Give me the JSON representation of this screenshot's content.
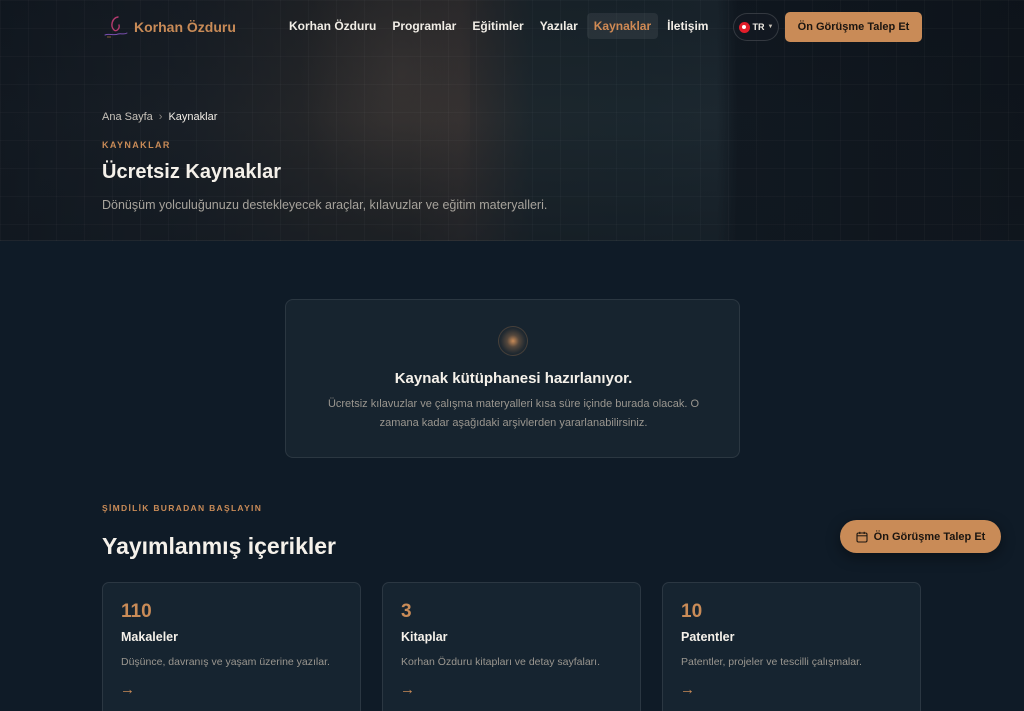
{
  "brand": {
    "name": "Korhan Özduru",
    "accent": "#c98b57",
    "logo_icon": "signature-logo-icon"
  },
  "nav": {
    "links": [
      {
        "label": "Korhan Özduru",
        "active": false
      },
      {
        "label": "Programlar",
        "active": false
      },
      {
        "label": "Eğitimler",
        "active": false
      },
      {
        "label": "Yazılar",
        "active": false
      },
      {
        "label": "Kaynaklar",
        "active": true
      },
      {
        "label": "İletişim",
        "active": false
      }
    ],
    "language": {
      "code": "TR",
      "flag_icon": "turkey-flag-icon"
    },
    "cta_label": "Ön Görüşme Talep Et"
  },
  "hero": {
    "breadcrumb": {
      "home": "Ana Sayfa",
      "separator": "›",
      "current": "Kaynaklar"
    },
    "eyebrow": "KAYNAKLAR",
    "title": "Ücretsiz Kaynaklar",
    "subtitle": "Dönüşüm yolculuğunuzu destekleyecek araçlar, kılavuzlar ve eğitim materyalleri."
  },
  "notice": {
    "title": "Kaynak kütüphanesi hazırlanıyor.",
    "text": "Ücretsiz kılavuzlar ve çalışma materyalleri kısa süre içinde burada olacak. O zamana kadar aşağıdaki arşivlerden yararlanabilirsiniz."
  },
  "section": {
    "eyebrow": "ŞİMDİLİK BURADAN BAŞLAYIN",
    "title": "Yayımlanmış içerikler",
    "cards": [
      {
        "count": "110",
        "title": "Makaleler",
        "description": "Düşünce, davranış ve yaşam üzerine yazılar.",
        "arrow": "→"
      },
      {
        "count": "3",
        "title": "Kitaplar",
        "description": "Korhan Özduru kitapları ve detay sayfaları.",
        "arrow": "→"
      },
      {
        "count": "10",
        "title": "Patentler",
        "description": "Patentler, projeler ve tescilli çalışmalar.",
        "arrow": "→"
      }
    ]
  },
  "floating_cta": {
    "label": "Ön Görüşme Talep Et",
    "icon": "calendar-icon"
  }
}
